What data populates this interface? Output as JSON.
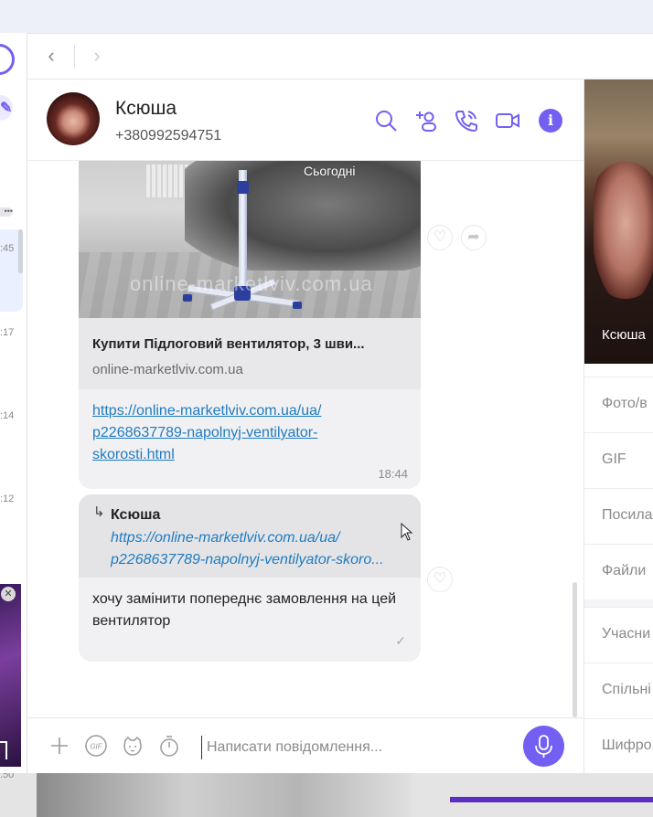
{
  "contact": {
    "name": "Ксюша",
    "phone": "+380992594751"
  },
  "header_icons": [
    "search-icon",
    "add-contact-icon",
    "call-icon",
    "video-call-icon",
    "info-icon"
  ],
  "sidebar_times": [
    ":45",
    ":17",
    ":14",
    ":12",
    ":50"
  ],
  "link_preview": {
    "date_label": "Сьогодні",
    "watermark": "online-marketlviv.com.ua",
    "title": "Купити Підлоговий вентилятор, 3 шви...",
    "domain": "online-marketlviv.com.ua",
    "url_lines": [
      "https://online-marketlviv.com.ua/ua/",
      "p2268637789-napolnyj-ventilyator-",
      "skorosti.html"
    ],
    "time": "18:44"
  },
  "reply_message": {
    "quote_author": "Ксюша",
    "quote_lines": [
      "https://online-marketlviv.com.ua/ua/",
      "p2268637789-napolnyj-ventilyator-skoro..."
    ],
    "text": "хочу замінити попереднє замовлення на цей вентилятор"
  },
  "composer": {
    "placeholder": "Написати повідомлення..."
  },
  "info_panel": {
    "photo_name": "Ксюша",
    "rows": [
      "Фото/в",
      "GIF",
      "Посила",
      "Файли",
      "Учасни",
      "Спільні",
      "Шифро"
    ]
  },
  "colors": {
    "accent": "#7360f2",
    "link": "#1f7bc1",
    "bubble": "#f1f1f3"
  }
}
